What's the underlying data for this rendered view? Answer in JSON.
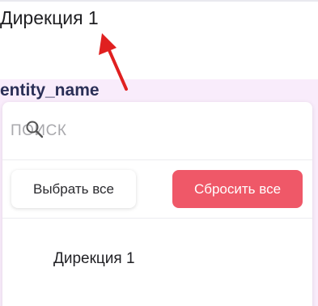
{
  "filter": {
    "selected_value": "Дирекция 1",
    "entity_label": "entity_name"
  },
  "dropdown": {
    "search": {
      "placeholder": "ПОИСК",
      "value": ""
    },
    "select_all_label": "Выбрать все",
    "reset_label": "Сбросить все",
    "options": [
      {
        "label": "Дирекция 1"
      }
    ]
  },
  "colors": {
    "accent_reset": "#ef5868",
    "panel_background": "#f9ecfb",
    "label_color": "#2b2f57",
    "arrow": "#e02020"
  },
  "icons": {
    "search": "search-icon",
    "annotation": "arrow-icon"
  }
}
